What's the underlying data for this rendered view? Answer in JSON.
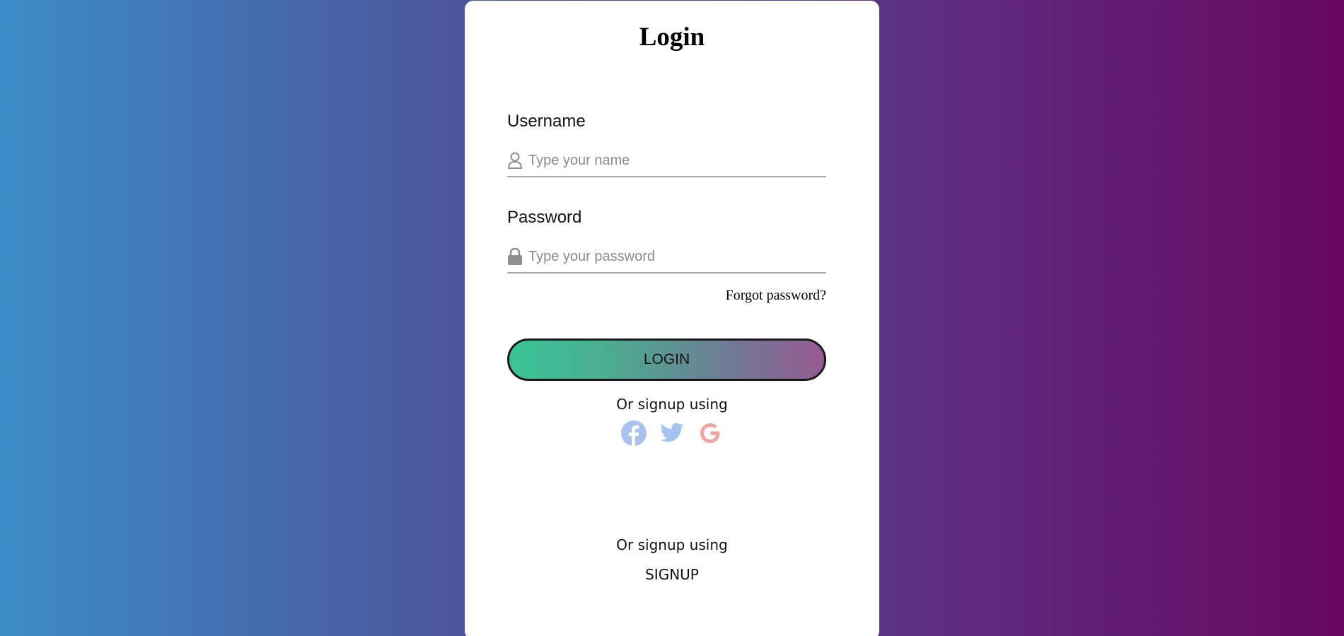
{
  "login": {
    "title": "Login",
    "username_label": "Username",
    "username_placeholder": "Type your name",
    "password_label": "Password",
    "password_placeholder": "Type your password",
    "forgot_text": "Forgot password?",
    "login_button": "LOGIN",
    "signup_using_text": "Or signup using",
    "social_icons": [
      "facebook-icon",
      "twitter-icon",
      "google-icon"
    ],
    "signup_using_text_2": "Or signup using",
    "signup_button": "SIGNUP"
  },
  "colors": {
    "facebook": "#a9c1ee",
    "twitter": "#a3c3ef",
    "google": "#f0a4a4",
    "field_icon": "#8e8e8e"
  }
}
